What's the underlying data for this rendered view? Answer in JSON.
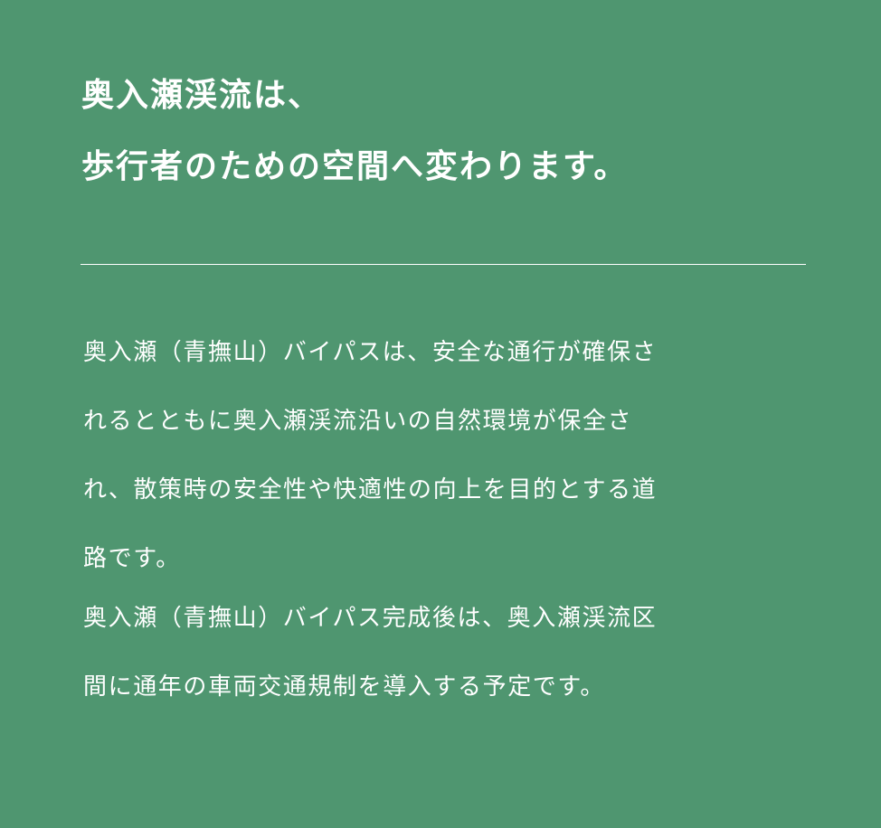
{
  "heading": {
    "lines": [
      "奥入瀬渓流は、",
      "歩行者のための空間へ変わります。"
    ]
  },
  "body": {
    "lines": [
      "奥入瀬（青撫山）バイパスは、安全な通行が確保さ",
      "れるとともに奥入瀬渓流沿いの自然環境が保全さ",
      "れ、散策時の安全性や快適性の向上を目的とする道",
      "路です。",
      "奥入瀬（青撫山）バイパス完成後は、奥入瀬渓流区",
      "間に通年の車両交通規制を導入する予定です。"
    ]
  },
  "colors": {
    "background": "#4f9670",
    "text": "#ffffff"
  }
}
